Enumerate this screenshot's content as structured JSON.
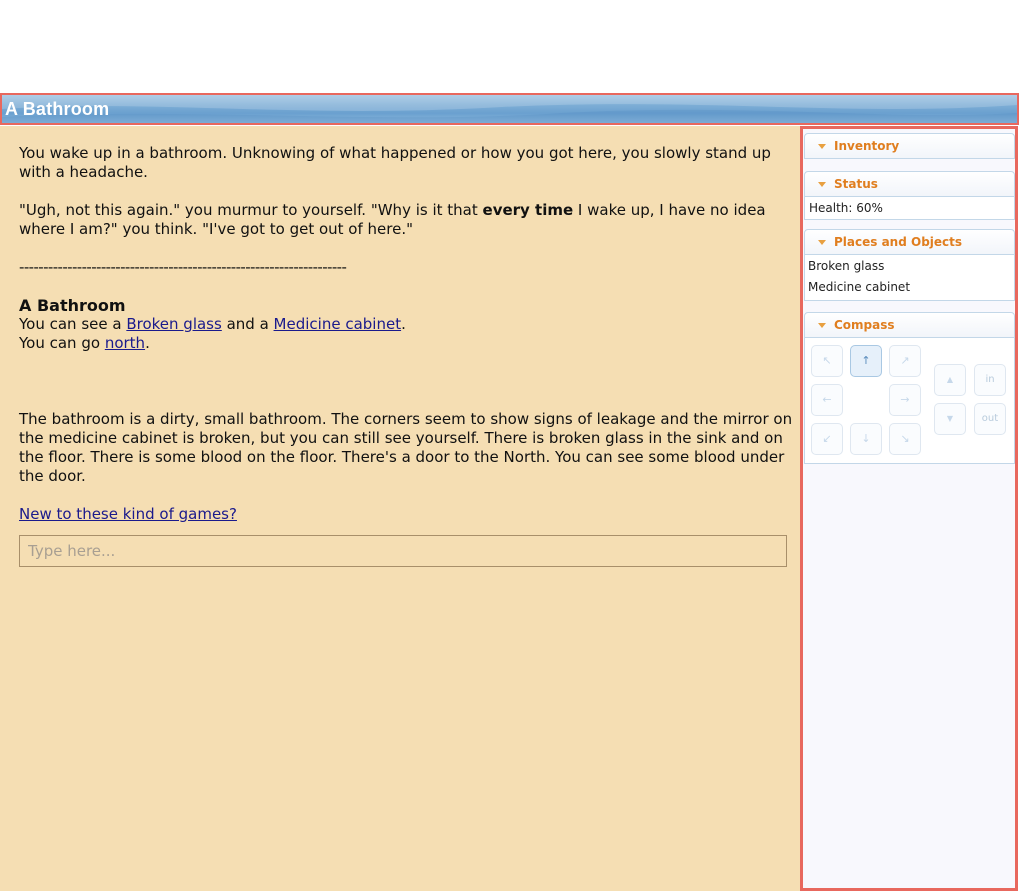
{
  "header": {
    "title": "A Bathroom"
  },
  "story": {
    "intro": "You wake up in a bathroom. Unknowing of what happened or how you got here, you slowly stand up with a headache.",
    "quote_before": "\"Ugh, not this again.\" you murmur to yourself. \"Why is it that ",
    "quote_bold": "every time",
    "quote_after": " I wake up, I have no idea where I am?\" you think. \"I've got to get out of here.\"",
    "separator": "--------------------------------------------------------------------",
    "room_title": "A Bathroom",
    "see_prefix": "You can see a ",
    "object1": "Broken glass",
    "see_middle": " and a ",
    "object2": "Medicine cabinet",
    "see_suffix": ".",
    "go_prefix": "You can go ",
    "exit": "north",
    "go_suffix": ".",
    "description": "The bathroom is a dirty, small bathroom. The corners seem to show signs of leakage and the mirror on the medicine cabinet is broken, but you can still see yourself. There is broken glass in the sink and on the floor. There is some blood on the floor. There's a door to the North. You can see some blood under the door.",
    "help_link": "New to these kind of games?"
  },
  "input": {
    "placeholder": "Type here..."
  },
  "sidebar": {
    "inventory": {
      "label": "Inventory"
    },
    "status": {
      "label": "Status",
      "health": "Health: 60%"
    },
    "places": {
      "label": "Places and Objects",
      "items": [
        "Broken glass",
        "Medicine cabinet"
      ]
    },
    "compass": {
      "label": "Compass",
      "nw": "↖",
      "n": "↑",
      "ne": "↗",
      "w": "←",
      "e": "→",
      "sw": "↙",
      "s": "↓",
      "se": "↘",
      "up": "▲",
      "down": "▼",
      "in": "in",
      "out": "out",
      "active_direction": "n"
    }
  },
  "colors": {
    "main_background": "#f5deb3",
    "header_accent": "#e07e1f",
    "link": "#1a1a8c",
    "title_bar": "#7eaed6"
  }
}
